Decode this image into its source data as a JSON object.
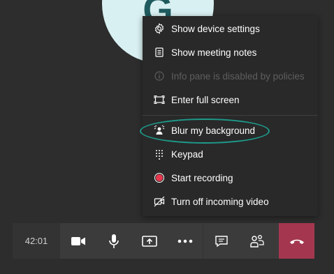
{
  "participant": {
    "initial": "G"
  },
  "menu": {
    "items": [
      {
        "label": "Show device settings",
        "icon": "gear-icon",
        "enabled": true
      },
      {
        "label": "Show meeting notes",
        "icon": "notes-icon",
        "enabled": true
      },
      {
        "label": "Info pane is disabled by policies",
        "icon": "info-icon",
        "enabled": false
      },
      {
        "label": "Enter full screen",
        "icon": "fullscreen-icon",
        "enabled": true
      },
      {
        "label": "Blur my background",
        "icon": "blur-background-icon",
        "enabled": true
      },
      {
        "label": "Keypad",
        "icon": "keypad-icon",
        "enabled": true
      },
      {
        "label": "Start recording",
        "icon": "record-icon",
        "enabled": true
      },
      {
        "label": "Turn off incoming video",
        "icon": "video-off-icon",
        "enabled": true
      }
    ]
  },
  "callbar": {
    "timer": "42:01",
    "buttons": [
      "camera-icon",
      "microphone-icon",
      "share-screen-icon",
      "more-icon",
      "chat-icon",
      "participants-icon"
    ],
    "hangup_icon": "hang-up-icon"
  },
  "colors": {
    "background": "#2d2d2d",
    "menu": "#292929",
    "highlight": "#1d9a8a",
    "hangup": "#a4374f",
    "record": "#e8384f"
  }
}
